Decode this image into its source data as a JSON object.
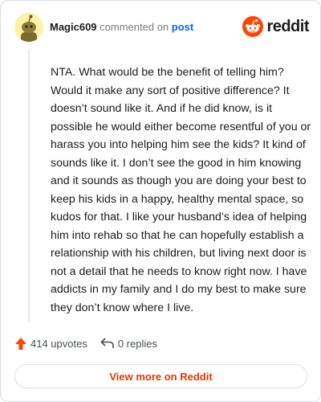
{
  "comment": {
    "username": "Magic609",
    "commented_on_text": "commented on",
    "post_link_text": "post",
    "body": "NTA. What would be the benefit of telling him? Would it make any sort of positive difference? It doesn’t sound like it. And if he did know, is it possible he would either become resentful of you or harass you into helping him see the kids? It kind of sounds like it. I don’t see the good in him knowing and it sounds as though you are doing your best to keep his kids in a happy, healthy mental space, so kudos for that. I like your husband’s idea of helping him into rehab so that he can hopefully establish a relationship with his children, but living next door is not a detail that he needs to know right now. I have addicts in my family and I do my best to make sure they don’t know where I live."
  },
  "brand": {
    "name": "reddit",
    "icon": "reddit-logo-icon",
    "color": "#ff4500"
  },
  "actions": {
    "upvotes_label": "414 upvotes",
    "upvote_icon": "upvote-arrow-icon",
    "upvote_color": "#ff4500",
    "replies_label": "0 replies",
    "reply_icon": "reply-arrow-icon"
  },
  "footer": {
    "view_more_label": "View more on Reddit",
    "view_more_color": "#d93a00"
  }
}
